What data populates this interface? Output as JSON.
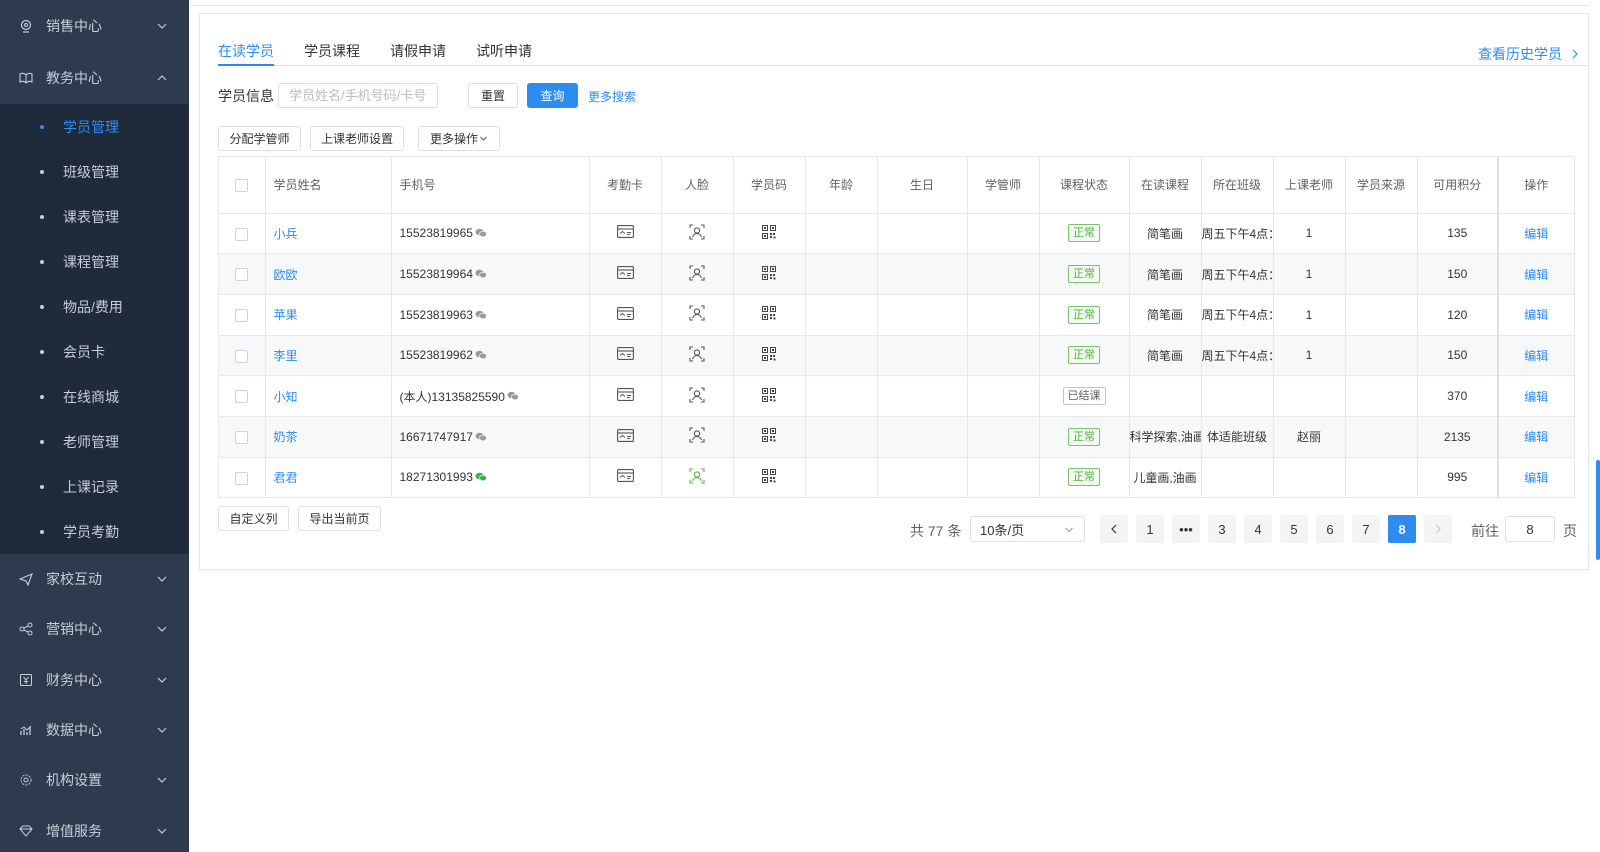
{
  "sidebar": {
    "sales": "销售中心",
    "edu": "教务中心",
    "edu_items": [
      "学员管理",
      "班级管理",
      "课表管理",
      "课程管理",
      "物品/费用",
      "会员卡",
      "在线商城",
      "老师管理",
      "上课记录",
      "学员考勤"
    ],
    "active_index": 0,
    "bottom": [
      "家校互动",
      "营销中心",
      "财务中心",
      "数据中心",
      "机构设置",
      "增值服务"
    ],
    "active_color": "#2d8cf0",
    "bg_color": "#2e3a4e"
  },
  "tabs": [
    "在读学员",
    "学员课程",
    "请假申请",
    "试听申请"
  ],
  "active_tab": 0,
  "history_link": "查看历史学员",
  "search": {
    "label": "学员信息",
    "placeholder": "学员姓名/手机号码/卡号",
    "reset": "重置",
    "query": "查询",
    "more": "更多搜索"
  },
  "actions": {
    "assign": "分配学管师",
    "teacher": "上课老师设置",
    "more": "更多操作"
  },
  "table": {
    "headers": [
      "学员姓名",
      "手机号",
      "考勤卡",
      "人脸",
      "学员码",
      "年龄",
      "生日",
      "学管师",
      "课程状态",
      "在读课程",
      "所在班级",
      "上课老师",
      "学员来源",
      "可用积分",
      "操作"
    ],
    "rows": [
      {
        "name": "小兵",
        "phone": "15523819965",
        "wechat": false,
        "face_green": false,
        "status": "正常",
        "status_type": "ok",
        "course": "简笔画",
        "class": "周五下午4点：",
        "teacher": "1",
        "points": "135",
        "op": "编辑"
      },
      {
        "name": "欧欧",
        "phone": "15523819964",
        "wechat": false,
        "face_green": false,
        "status": "正常",
        "status_type": "ok",
        "course": "简笔画",
        "class": "周五下午4点：",
        "teacher": "1",
        "points": "150",
        "op": "编辑"
      },
      {
        "name": "苹果",
        "phone": "15523819963",
        "wechat": false,
        "face_green": false,
        "status": "正常",
        "status_type": "ok",
        "course": "简笔画",
        "class": "周五下午4点：",
        "teacher": "1",
        "points": "120",
        "op": "编辑"
      },
      {
        "name": "李里",
        "phone": "15523819962",
        "wechat": false,
        "face_green": false,
        "status": "正常",
        "status_type": "ok",
        "course": "简笔画",
        "class": "周五下午4点：",
        "teacher": "1",
        "points": "150",
        "op": "编辑"
      },
      {
        "name": "小知",
        "phone": "(本人)13135825590",
        "wechat": false,
        "face_green": false,
        "status": "已结课",
        "status_type": "end",
        "course": "",
        "class": "",
        "teacher": "",
        "points": "370",
        "op": "编辑"
      },
      {
        "name": "奶茶",
        "phone": "16671747917",
        "wechat": false,
        "face_green": false,
        "status": "正常",
        "status_type": "ok",
        "course": "科学探索,油画",
        "class": "体适能班级",
        "teacher": "赵丽",
        "points": "2135",
        "op": "编辑"
      },
      {
        "name": "君君",
        "phone": "18271301993",
        "wechat": true,
        "face_green": true,
        "status": "正常",
        "status_type": "ok",
        "course": "儿童画,油画",
        "class": "",
        "teacher": "",
        "points": "995",
        "op": "编辑"
      }
    ]
  },
  "footer": {
    "custom_cols": "自定义列",
    "export": "导出当前页",
    "total": "共 77 条",
    "page_size": "10条/页",
    "pages": [
      "1",
      "•••",
      "3",
      "4",
      "5",
      "6",
      "7",
      "8"
    ],
    "current_page": "8",
    "goto_label": "前往",
    "goto_value": "8",
    "goto_suffix": "页"
  }
}
